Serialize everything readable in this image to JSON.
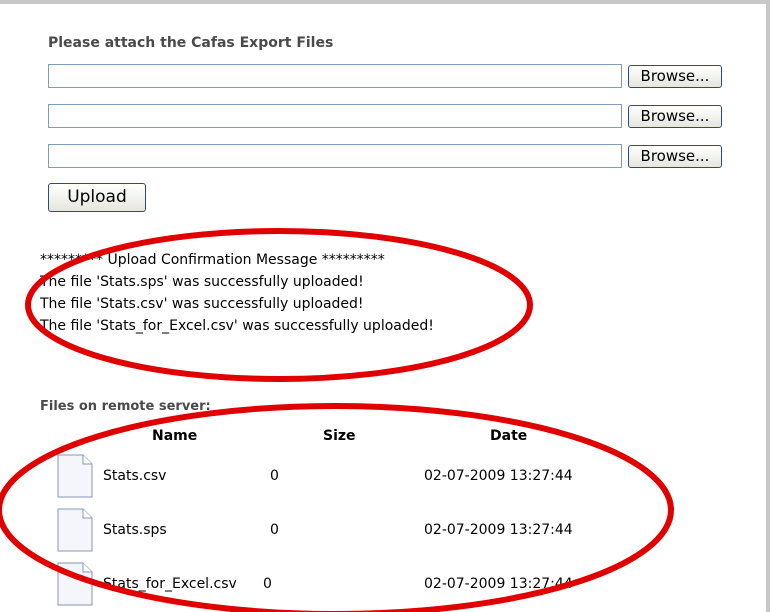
{
  "upload_form": {
    "heading": "Please attach the Cafas Export Files",
    "browse_label": "Browse...",
    "file_inputs": [
      {
        "value": "",
        "browse_label": "Browse..."
      },
      {
        "value": "",
        "browse_label": "Browse..."
      },
      {
        "value": "",
        "browse_label": "Browse..."
      }
    ],
    "upload_label": "Upload"
  },
  "confirmation": {
    "title": "********* Upload Confirmation Message *********",
    "lines": [
      "The file 'Stats.sps' was successfully uploaded!",
      "The file 'Stats.csv' was successfully uploaded!",
      "The file 'Stats_for_Excel.csv' was successfully uploaded!"
    ]
  },
  "remote_files": {
    "title": "Files on remote server:",
    "columns": [
      "Name",
      "Size",
      "Date"
    ],
    "rows": [
      {
        "icon": "document-icon",
        "name": "Stats.csv",
        "size": "0",
        "date": "02-07-2009 13:27:44"
      },
      {
        "icon": "document-icon",
        "name": "Stats.sps",
        "size": "0",
        "date": "02-07-2009 13:27:44"
      },
      {
        "icon": "document-icon",
        "name": "Stats_for_Excel.csv",
        "size": "0",
        "date": "02-07-2009 13:27:44"
      }
    ]
  },
  "annotation_color": "#e00000"
}
